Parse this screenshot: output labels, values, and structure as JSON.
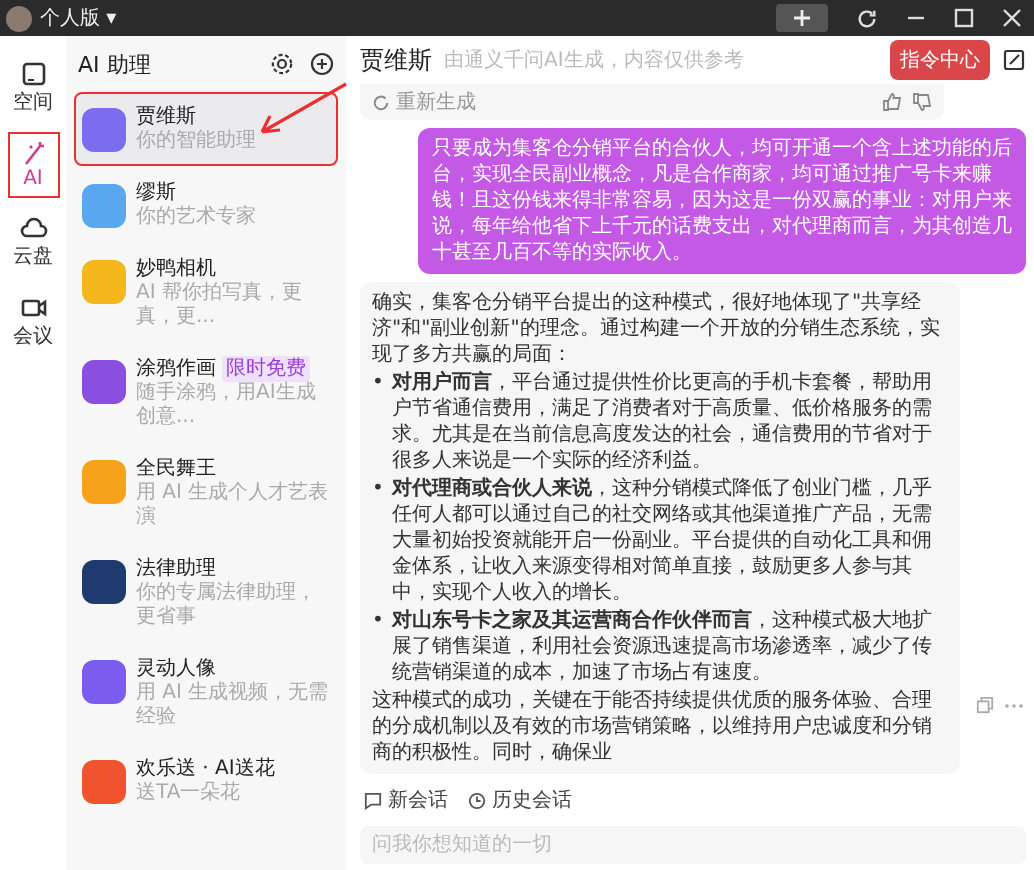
{
  "titlebar": {
    "account": "个人版",
    "caret": "▾"
  },
  "rail": [
    {
      "label": "空间",
      "selected": false,
      "highlighted": false
    },
    {
      "label": "AI",
      "selected": true,
      "highlighted": true
    },
    {
      "label": "云盘",
      "selected": false,
      "highlighted": false
    },
    {
      "label": "会议",
      "selected": false,
      "highlighted": false
    }
  ],
  "sidebar": {
    "title": "AI 助理",
    "items": [
      {
        "name": "贾维斯",
        "desc": "你的智能助理",
        "color": "#7b6cf0",
        "selected": true,
        "highlighted": true
      },
      {
        "name": "缪斯",
        "desc": "你的艺术专家",
        "color": "#5aa8f0",
        "selected": false,
        "highlighted": false
      },
      {
        "name": "妙鸭相机",
        "desc": "AI 帮你拍写真，更真，更...",
        "color": "#f5b81c",
        "selected": false,
        "highlighted": false
      },
      {
        "name": "涂鸦作画",
        "desc": "随手涂鸦，用AI生成创意...",
        "badge": "限时免费",
        "color": "#8a4ee0",
        "selected": false,
        "highlighted": false
      },
      {
        "name": "全民舞王",
        "desc": "用 AI 生成个人才艺表演",
        "color": "#f7a21b",
        "selected": false,
        "highlighted": false
      },
      {
        "name": "法律助理",
        "desc": "你的专属法律助理，更省事",
        "color": "#1e3a6e",
        "selected": false,
        "highlighted": false
      },
      {
        "name": "灵动人像",
        "desc": "用 AI 生成视频，无需经验",
        "color": "#7a5cf0",
        "selected": false,
        "highlighted": false
      },
      {
        "name": "欢乐送 · AI送花",
        "desc": "送TA一朵花",
        "color": "#f0532d",
        "selected": false,
        "highlighted": false
      }
    ]
  },
  "chat": {
    "title": "贾维斯",
    "subtitle": "由通义千问AI生成，内容仅供参考",
    "command_button": "指令中心",
    "regenerate": "重新生成",
    "user_message": "只要成为集客仓分销平台的合伙人，均可开通一个含上述功能的后台，实现全民副业概念，凡是合作商家，均可通过推广号卡来赚钱！且这份钱来得非常容易，因为这是一份双赢的事业：对用户来说，每年给他省下上千元的话费支出，对代理商而言，为其创造几十甚至几百不等的实际收入。",
    "reply_intro": "确实，集客仓分销平台提出的这种模式，很好地体现了\"共享经济\"和\"副业创新\"的理念。通过构建一个开放的分销生态系统，实现了多方共赢的局面：",
    "reply_points": [
      {
        "marker": "•",
        "text": "**对用户而言**，平台通过提供性价比更高的手机卡套餐，帮助用户节省通信费用，满足了消费者对于高质量、低价格服务的需求。尤其是在当前信息高度发达的社会，通信费用的节省对于很多人来说是一个实际的经济利益。"
      },
      {
        "marker": "•",
        "text": "**对代理商或合伙人来说**，这种分销模式降低了创业门槛，几乎任何人都可以通过自己的社交网络或其他渠道推广产品，无需大量初始投资就能开启一份副业。平台提供的自动化工具和佣金体系，让收入来源变得相对简单直接，鼓励更多人参与其中，实现个人收入的增长。"
      },
      {
        "marker": "•",
        "text": "**对山东号卡之家及其运营商合作伙伴而言**，这种模式极大地扩展了销售渠道，利用社会资源迅速提高市场渗透率，减少了传统营销渠道的成本，加速了市场占有速度。"
      }
    ],
    "reply_outro": "这种模式的成功，关键在于能否持续提供优质的服务体验、合理的分成机制以及有效的市场营销策略，以维持用户忠诚度和分销商的积极性。同时，确保业",
    "new_session": "新会话",
    "history": "历史会话",
    "input_placeholder": "问我你想知道的一切"
  }
}
